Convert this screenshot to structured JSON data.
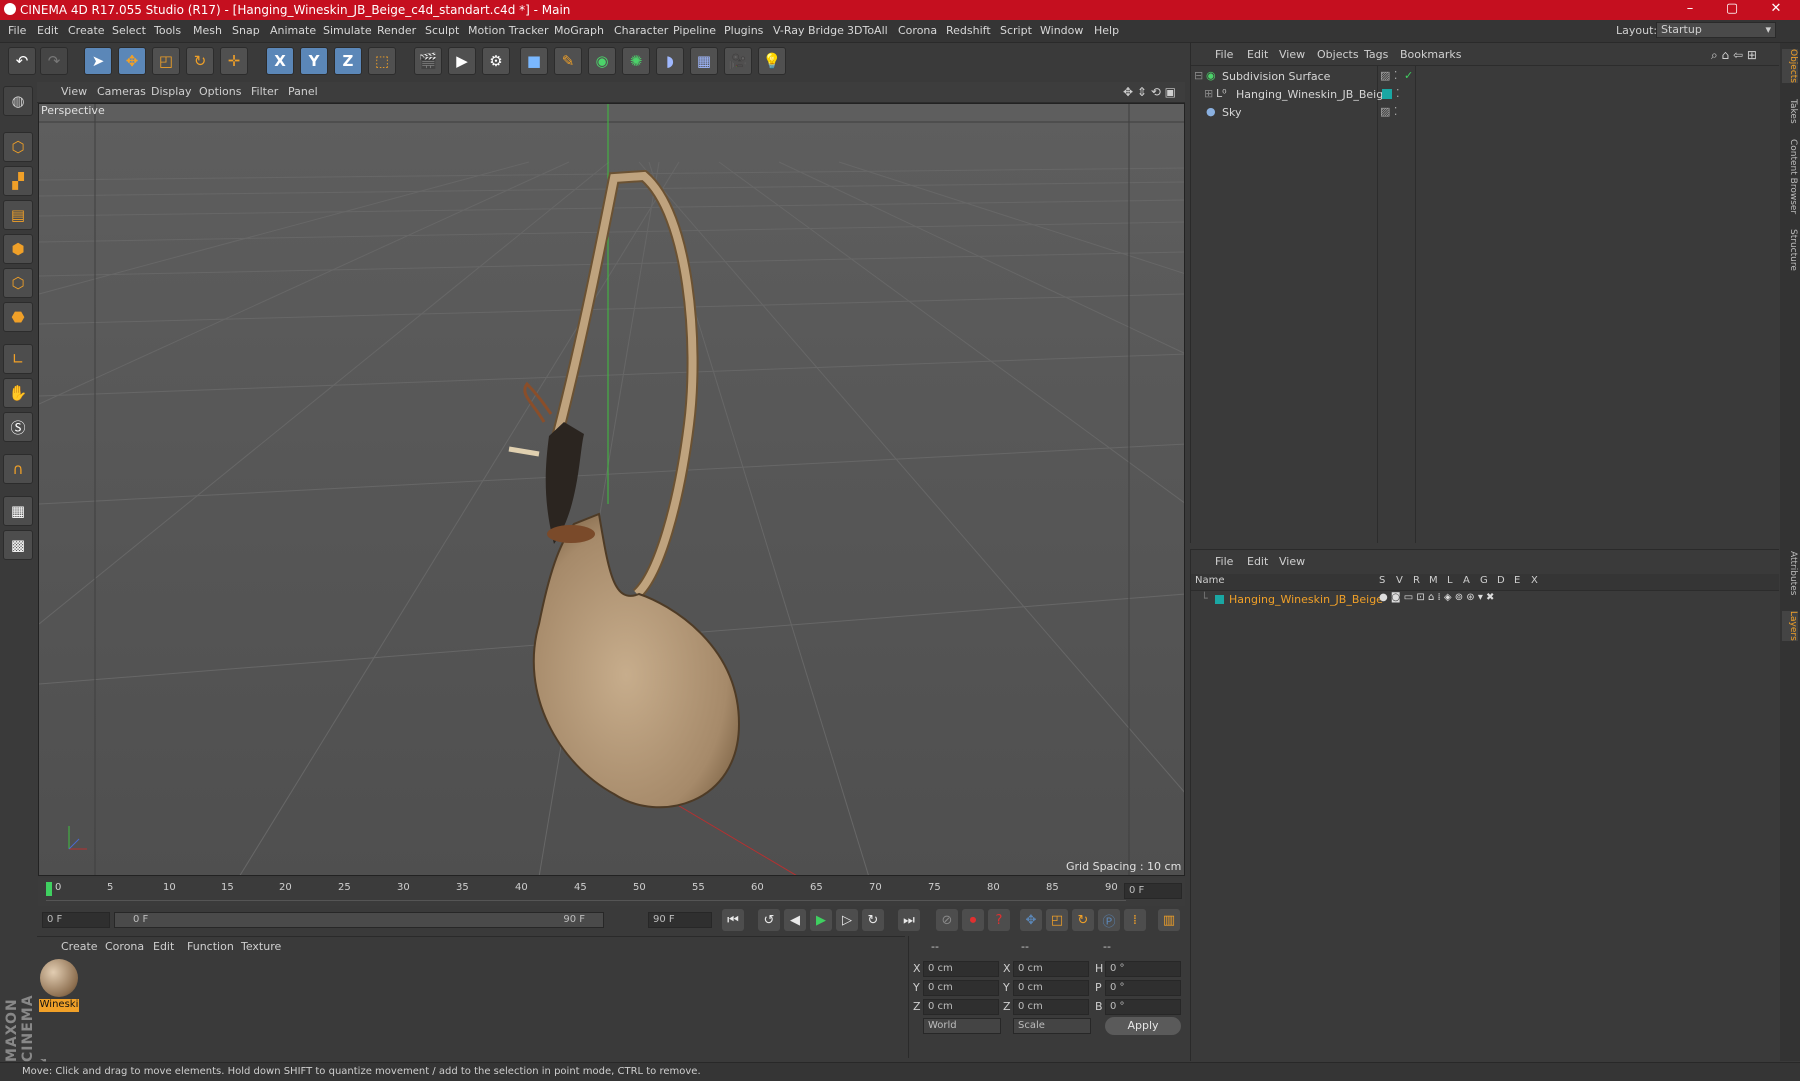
{
  "window": {
    "title": "CINEMA 4D R17.055 Studio (R17) - [Hanging_Wineskin_JB_Beige_c4d_standart.c4d *] - Main",
    "controls": [
      "–",
      "▢",
      "✕"
    ]
  },
  "menubar": {
    "items": [
      "File",
      "Edit",
      "Create",
      "Select",
      "Tools",
      "Mesh",
      "Snap",
      "Animate",
      "Simulate",
      "Render",
      "Sculpt",
      "Motion Tracker",
      "MoGraph",
      "Character",
      "Pipeline",
      "Plugins",
      "V-Ray Bridge",
      "3DToAll",
      "Corona",
      "Redshift",
      "Script",
      "Window",
      "Help"
    ],
    "layout_label": "Layout:",
    "layout_value": "Startup"
  },
  "toolbar": {
    "icons": [
      "undo-icon",
      "redo-icon",
      "select-arrow-icon",
      "move-icon",
      "scale-icon",
      "rotate-icon",
      "live-move-icon",
      "x-axis-icon",
      "y-axis-icon",
      "z-axis-icon",
      "world-coord-icon",
      "render-view-icon",
      "render-picture-icon",
      "edit-render-settings-icon",
      "cube-icon",
      "pen-spline-icon",
      "nurbs-icon",
      "array-icon",
      "deformer-icon",
      "floor-icon",
      "camera-icon",
      "light-icon"
    ],
    "axis_labels": [
      "X",
      "Y",
      "Z"
    ]
  },
  "viewport": {
    "menu": [
      "View",
      "Cameras",
      "Display",
      "Options",
      "Filter",
      "Panel"
    ],
    "label": "Perspective",
    "grid_spacing": "Grid Spacing : 10 cm"
  },
  "timeline": {
    "ticks": [
      "0",
      "5",
      "10",
      "15",
      "20",
      "25",
      "30",
      "35",
      "40",
      "45",
      "50",
      "55",
      "60",
      "65",
      "70",
      "75",
      "80",
      "85",
      "90"
    ],
    "current_frame_field": "0 F",
    "start_field": "0 F",
    "range_start": "0 F",
    "range_end": "90 F",
    "end_field": "90 F"
  },
  "materials": {
    "menu": [
      "Create",
      "Corona",
      "Edit",
      "Function",
      "Texture"
    ],
    "items": [
      {
        "label": "Wineski"
      }
    ]
  },
  "coordinates": {
    "headers": [
      "--",
      "--",
      "--"
    ],
    "rows": [
      {
        "a": "X",
        "av": "0 cm",
        "b": "X",
        "bv": "0 cm",
        "c": "H",
        "cv": "0 °"
      },
      {
        "a": "Y",
        "av": "0 cm",
        "b": "Y",
        "bv": "0 cm",
        "c": "P",
        "cv": "0 °"
      },
      {
        "a": "Z",
        "av": "0 cm",
        "b": "Z",
        "bv": "0 cm",
        "c": "B",
        "cv": "0 °"
      }
    ],
    "mode": "World",
    "type": "Scale",
    "apply": "Apply"
  },
  "objects": {
    "menu": [
      "File",
      "Edit",
      "View",
      "Objects",
      "Tags",
      "Bookmarks"
    ],
    "items": [
      "Subdivision Surface",
      "Hanging_Wineskin_JB_Beige",
      "Sky"
    ]
  },
  "layers": {
    "menu": [
      "File",
      "Edit",
      "View"
    ],
    "columns": [
      "Name",
      "S",
      "V",
      "R",
      "M",
      "L",
      "A",
      "G",
      "D",
      "E",
      "X"
    ],
    "items": [
      "Hanging_Wineskin_JB_Beige"
    ]
  },
  "side_tabs": [
    "Objects",
    "Takes",
    "Content Browser",
    "Structure",
    "Attributes",
    "Layers"
  ],
  "brand": "MAXON CINEMA 4D",
  "status": "Move: Click and drag to move elements. Hold down SHIFT to quantize movement / add to the selection in point mode, CTRL to remove.",
  "colors": {
    "title_bar": "#c50f1f",
    "accent": "#5b87b8",
    "layer_name": "#f0a028",
    "layer_color": "#1aa7a3"
  }
}
